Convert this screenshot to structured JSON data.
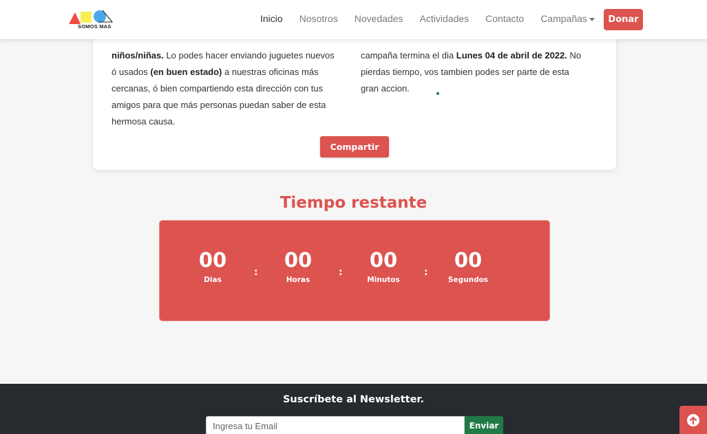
{
  "nav": {
    "logo_text": "SOMOS MAS",
    "links": [
      "Inicio",
      "Nosotros",
      "Novedades",
      "Actividades",
      "Contacto",
      "Campañas"
    ],
    "donate_label": "Donar"
  },
  "campaign": {
    "left_paragraph": {
      "line1_bold": "niños/niñas.",
      "line1_rest": " Lo podes hacer enviando juguetes nuevos",
      "line2_pre": "ó usados ",
      "line2_bold": "(en buen estado)",
      "line2_post": " a nuestras oficinas más",
      "line3": "cercanas, ó bien compartiendo esta dirección con tus",
      "line4": "amigos para que más personas puedan saber de esta",
      "line5": "hermosa causa."
    },
    "right_paragraph": {
      "line1_pre": "campaña termina el dia ",
      "line1_bold": "Lunes 04 de abril de 2022.",
      "line1_post": " No",
      "line2": "pierdas tiempo, vos tambien podes ser parte de esta",
      "line3": "gran accion."
    },
    "share_label": "Compartir"
  },
  "countdown": {
    "title": "Tiempo restante",
    "separator": ":",
    "units": [
      {
        "value": "00",
        "label": "Dias"
      },
      {
        "value": "00",
        "label": "Horas"
      },
      {
        "value": "00",
        "label": "Minutos"
      },
      {
        "value": "00",
        "label": "Segundos"
      }
    ]
  },
  "footer": {
    "newsletter_title": "Suscríbete al Newsletter.",
    "email_placeholder": "Ingresa tu Email",
    "send_label": "Enviar"
  },
  "colors": {
    "brand_red": "#dc5350",
    "send_green": "#1f7a45",
    "footer_dark": "#272b2f"
  },
  "icons": {
    "logo": "somos-mas-logo",
    "scroll_top": "arrow-up-circle-icon"
  }
}
